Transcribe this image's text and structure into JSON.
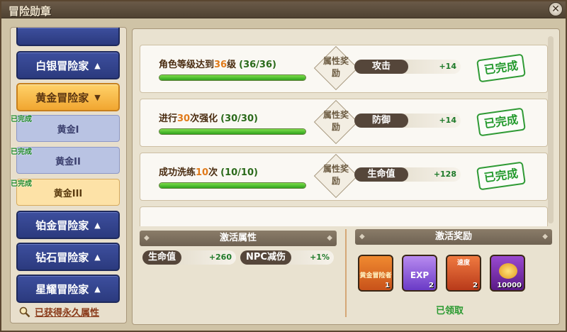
{
  "window": {
    "title": "冒险勋章",
    "close_icon": "close-icon"
  },
  "sidebar": {
    "top_label": "",
    "nav": [
      {
        "label": "白银冒险家",
        "arrow": "▲"
      },
      {
        "label": "黄金冒险家",
        "arrow": "▼"
      },
      {
        "label": "铂金冒险家",
        "arrow": "▲"
      },
      {
        "label": "钻石冒险家",
        "arrow": "▲"
      },
      {
        "label": "星耀冒险家",
        "arrow": "▲"
      }
    ],
    "sub_items": [
      {
        "done": "已完成",
        "label": "黄金I"
      },
      {
        "done": "已完成",
        "label": "黄金II"
      },
      {
        "done": "已完成",
        "label": "黄金III"
      }
    ],
    "permanent_link": "已获得永久属性"
  },
  "tasks": [
    {
      "pre": "角色等级达到",
      "num": "36",
      "post": "级",
      "progress_text": "(36/36)",
      "progress": 1.0,
      "reward_label": "属性奖励",
      "attr_name": "攻击",
      "attr_value": "+14",
      "status": "已完成"
    },
    {
      "pre": "进行",
      "num": "30",
      "post": "次强化",
      "progress_text": "(30/30)",
      "progress": 1.0,
      "reward_label": "属性奖励",
      "attr_name": "防御",
      "attr_value": "+14",
      "status": "已完成"
    },
    {
      "pre": "成功洗练",
      "num": "10",
      "post": "次",
      "progress_text": "(10/10)",
      "progress": 1.0,
      "reward_label": "属性奖励",
      "attr_name": "生命值",
      "attr_value": "+128",
      "status": "已完成"
    }
  ],
  "activation": {
    "attr_title": "激活属性",
    "reward_title": "激活奖励",
    "attrs": [
      {
        "name": "生命值",
        "value": "+260"
      },
      {
        "name": "NPC减伤",
        "value": "+1%"
      }
    ],
    "rewards": [
      {
        "label": "黄金冒险者",
        "count": "1",
        "color": "#e9701f"
      },
      {
        "label": "EXP",
        "count": "2",
        "color": "#8a4bd6"
      },
      {
        "label": "速度",
        "count": "2",
        "color": "#d8502a"
      },
      {
        "label": "",
        "count": "10000",
        "color": "#7a2aa8"
      }
    ],
    "claimed": "已领取"
  },
  "colors": {
    "complete": "#249a2e",
    "highlight": "#e07a1a",
    "nav_blue": "#2b3a7e",
    "nav_gold": "#f1a630"
  }
}
